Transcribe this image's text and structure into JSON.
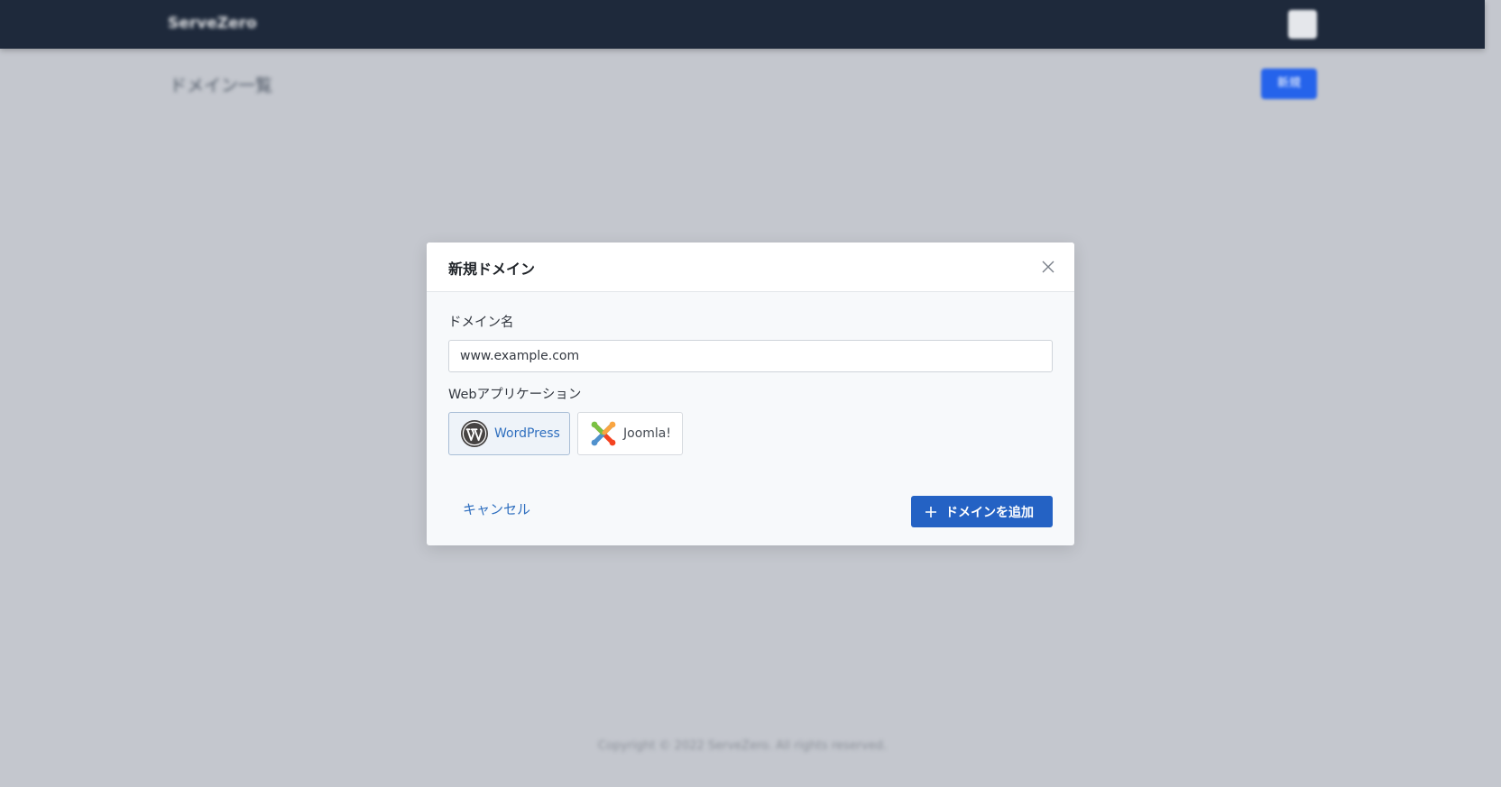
{
  "app": {
    "brand": "ServeZero",
    "page_title": "ドメイン一覧",
    "new_button_label": "新規",
    "footer": "Copyright © 2022 ServeZero. All rights reserved."
  },
  "modal": {
    "title": "新規ドメイン",
    "domain_label": "ドメイン名",
    "domain_value": "www.example.com",
    "webapp_label": "Webアプリケーション",
    "apps": [
      {
        "label": "WordPress",
        "icon": "wordpress-icon",
        "selected": true
      },
      {
        "label": "Joomla!",
        "icon": "joomla-icon",
        "selected": false
      }
    ],
    "cancel_label": "キャンセル",
    "add_label": "ドメインを追加"
  },
  "colors": {
    "topbar": "#1e293b",
    "overlay": "#c4c7ce",
    "primary": "#2462c4",
    "link": "#2f6fbf"
  }
}
